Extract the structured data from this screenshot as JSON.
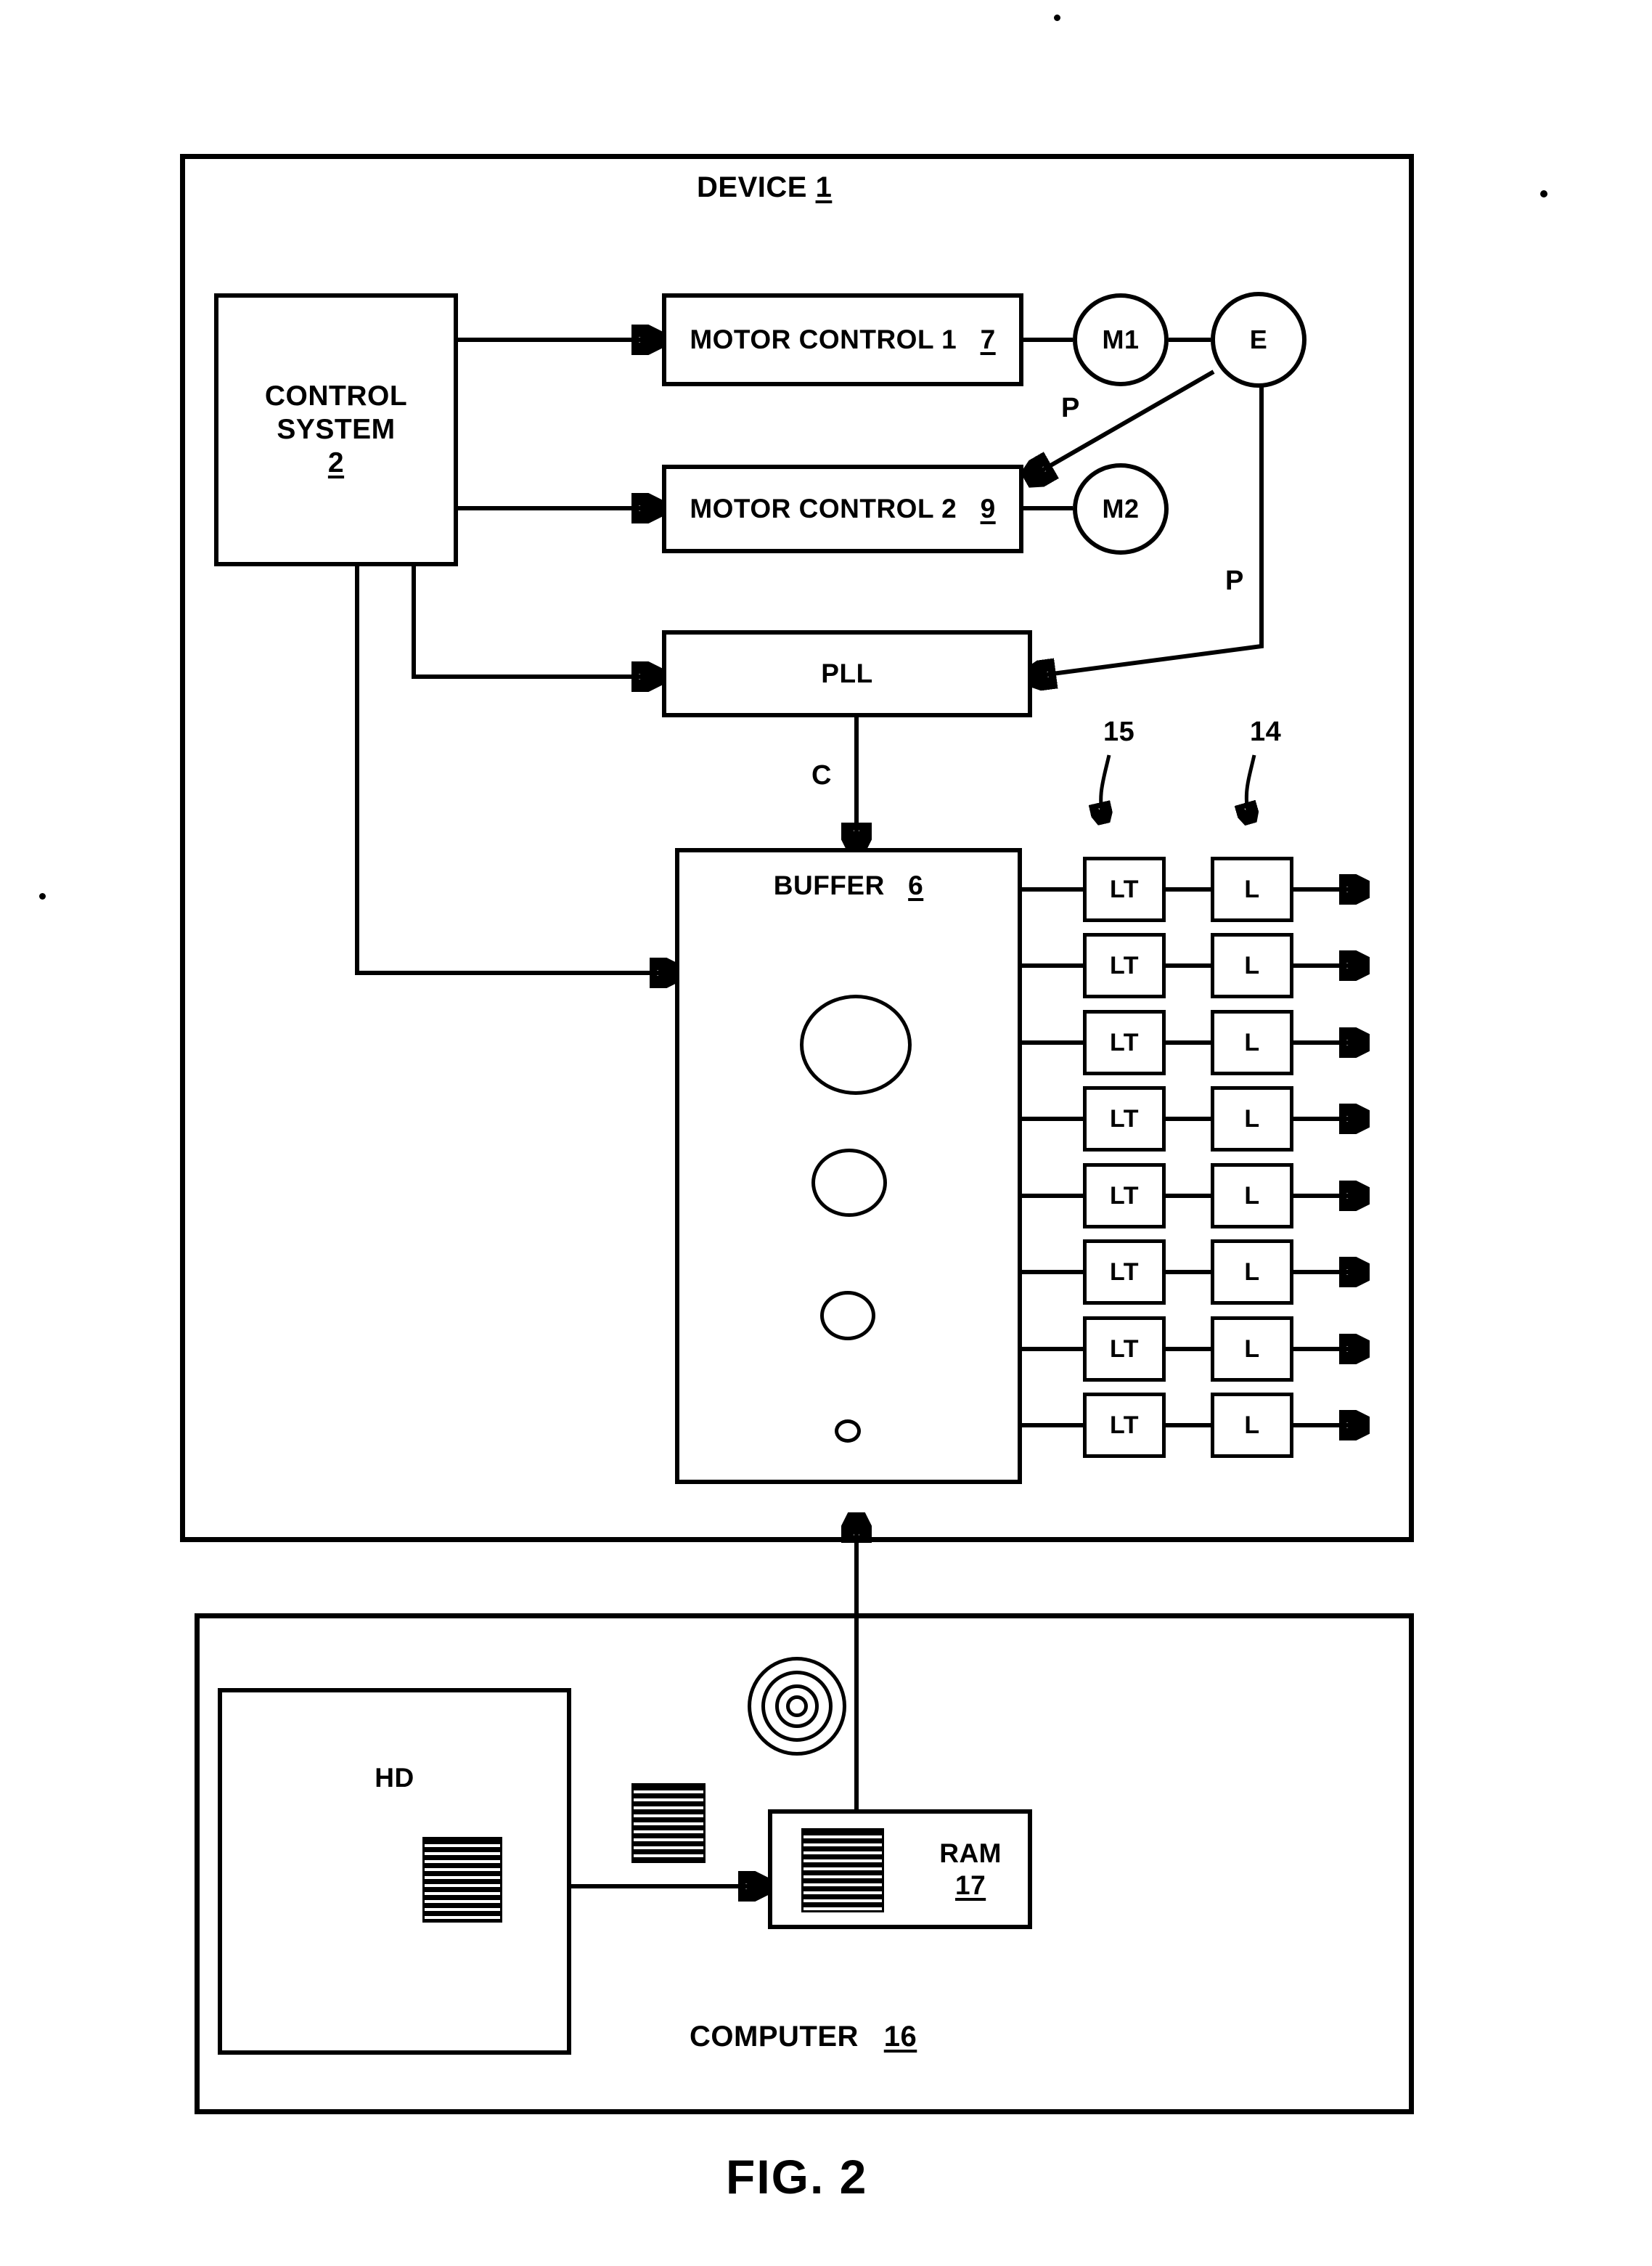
{
  "figure": {
    "caption": "FIG. 2"
  },
  "device": {
    "title_text": "DEVICE",
    "title_ref": "1"
  },
  "control_system": {
    "line1": "CONTROL",
    "line2": "SYSTEM",
    "ref": "2"
  },
  "motor_control_1": {
    "label": "MOTOR CONTROL 1",
    "ref": "7"
  },
  "motor_control_2": {
    "label": "MOTOR CONTROL 2",
    "ref": "9"
  },
  "motors": {
    "m1": "M1",
    "m2": "M2",
    "encoder": "E"
  },
  "pll": {
    "label": "PLL"
  },
  "signals": {
    "clock": "C",
    "position_1": "P",
    "position_2": "P"
  },
  "buffer": {
    "label": "BUFFER",
    "ref": "6"
  },
  "callouts": {
    "lt_column": "15",
    "l_column": "14"
  },
  "output_rows": [
    {
      "lt": "LT",
      "l": "L"
    },
    {
      "lt": "LT",
      "l": "L"
    },
    {
      "lt": "LT",
      "l": "L"
    },
    {
      "lt": "LT",
      "l": "L"
    },
    {
      "lt": "LT",
      "l": "L"
    },
    {
      "lt": "LT",
      "l": "L"
    },
    {
      "lt": "LT",
      "l": "L"
    },
    {
      "lt": "LT",
      "l": "L"
    }
  ],
  "computer": {
    "title_text": "COMPUTER",
    "title_ref": "16",
    "hd": {
      "label": "HD"
    },
    "ram": {
      "label": "RAM",
      "ref": "17"
    }
  },
  "icons": {
    "hd_data": "data-file-icon",
    "transfer_data": "data-file-icon",
    "ram_data": "data-file-icon",
    "concentric": "concentric-circles-icon"
  },
  "colors": {
    "ink": "#000000",
    "paper": "#ffffff"
  }
}
